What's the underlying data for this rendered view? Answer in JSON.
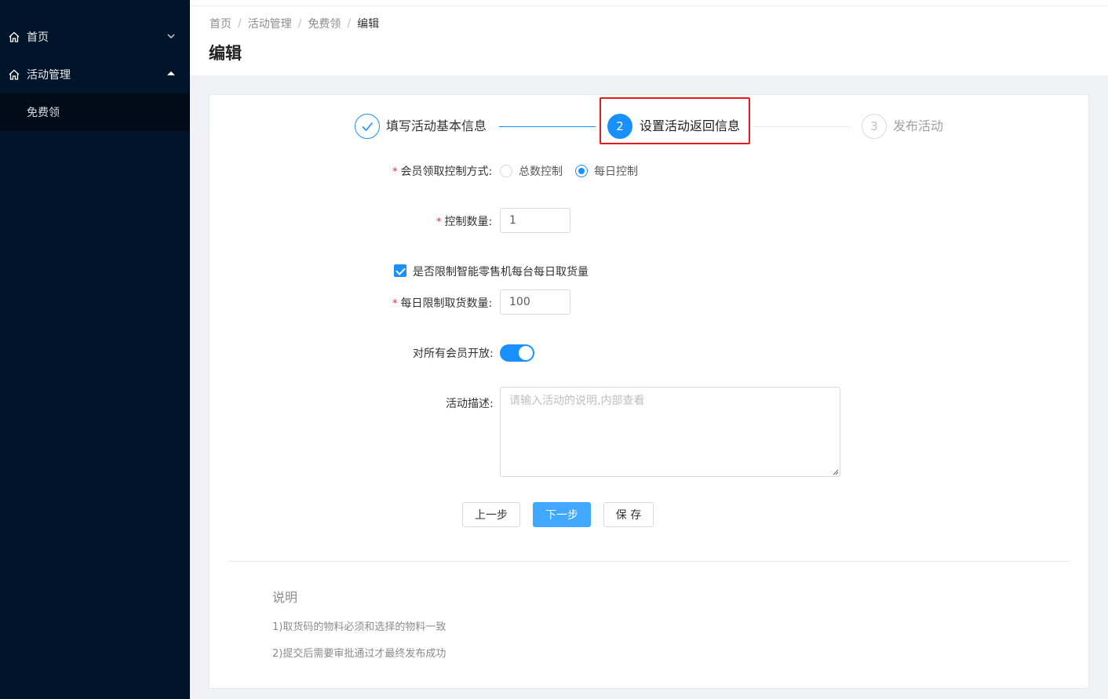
{
  "sidebar": {
    "items": [
      {
        "label": "首页",
        "icon": "home-icon",
        "expanded": false
      },
      {
        "label": "活动管理",
        "icon": "home-icon",
        "expanded": true
      }
    ],
    "submenu": [
      {
        "label": "免费领"
      }
    ]
  },
  "breadcrumb": [
    "首页",
    "活动管理",
    "免费领",
    "编辑"
  ],
  "page_title": "编辑",
  "steps": [
    {
      "index": "1",
      "title": "填写活动基本信息",
      "status": "finished"
    },
    {
      "index": "2",
      "title": "设置活动返回信息",
      "status": "active"
    },
    {
      "index": "3",
      "title": "发布活动",
      "status": "waiting"
    }
  ],
  "form": {
    "control_mode": {
      "label": "会员领取控制方式:",
      "options": [
        "总数控制",
        "每日控制"
      ],
      "selected": "每日控制"
    },
    "control_quantity": {
      "label": "控制数量:",
      "value": "1"
    },
    "limit_machine": {
      "label": "是否限制智能零售机每台每日取货量",
      "checked": true
    },
    "daily_limit": {
      "label": "每日限制取货数量:",
      "value": "100"
    },
    "open_to_all": {
      "label": "对所有会员开放:",
      "on": true
    },
    "description": {
      "label": "活动描述:",
      "placeholder": "请输入活动的说明,内部查看"
    }
  },
  "buttons": {
    "prev": "上一步",
    "next": "下一步",
    "save": "保 存"
  },
  "notes": {
    "title": "说明",
    "lines": [
      "1)取货码的物料必须和选择的物料一致",
      "2)提交后需要审批通过才最终发布成功"
    ]
  },
  "colors": {
    "sidebar_bg": "#001529",
    "primary": "#1890ff",
    "highlight": "#e81a1a"
  }
}
